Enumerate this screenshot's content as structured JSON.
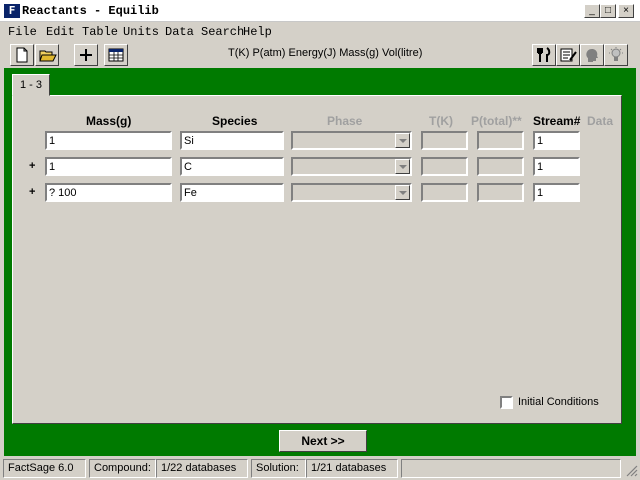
{
  "window": {
    "title": "Reactants - Equilib",
    "icon_letter": "F"
  },
  "menu": [
    "File",
    "Edit",
    "Table",
    "Units",
    "Data Search",
    "Help"
  ],
  "units_label": "T(K) P(atm) Energy(J) Mass(g) Vol(litre)",
  "tab": {
    "label": "1 - 3"
  },
  "columns": {
    "mass": "Mass(g)",
    "species": "Species",
    "phase": "Phase",
    "t": "T(K)",
    "p": "P(total)**",
    "stream": "Stream#",
    "data": "Data"
  },
  "rows": [
    {
      "plus": "",
      "mass": "1",
      "species": "Si",
      "stream": "1"
    },
    {
      "plus": "+",
      "mass": "1",
      "species": "C",
      "stream": "1"
    },
    {
      "plus": "+",
      "mass": "? 100",
      "species": "Fe",
      "stream": "1"
    }
  ],
  "initial_conditions_label": "Initial Conditions",
  "next_label": "Next >>",
  "status": {
    "version": "FactSage 6.0",
    "compound_label": "Compound:",
    "compound_value": "1/22 databases",
    "solution_label": "Solution:",
    "solution_value": "1/21 databases"
  }
}
